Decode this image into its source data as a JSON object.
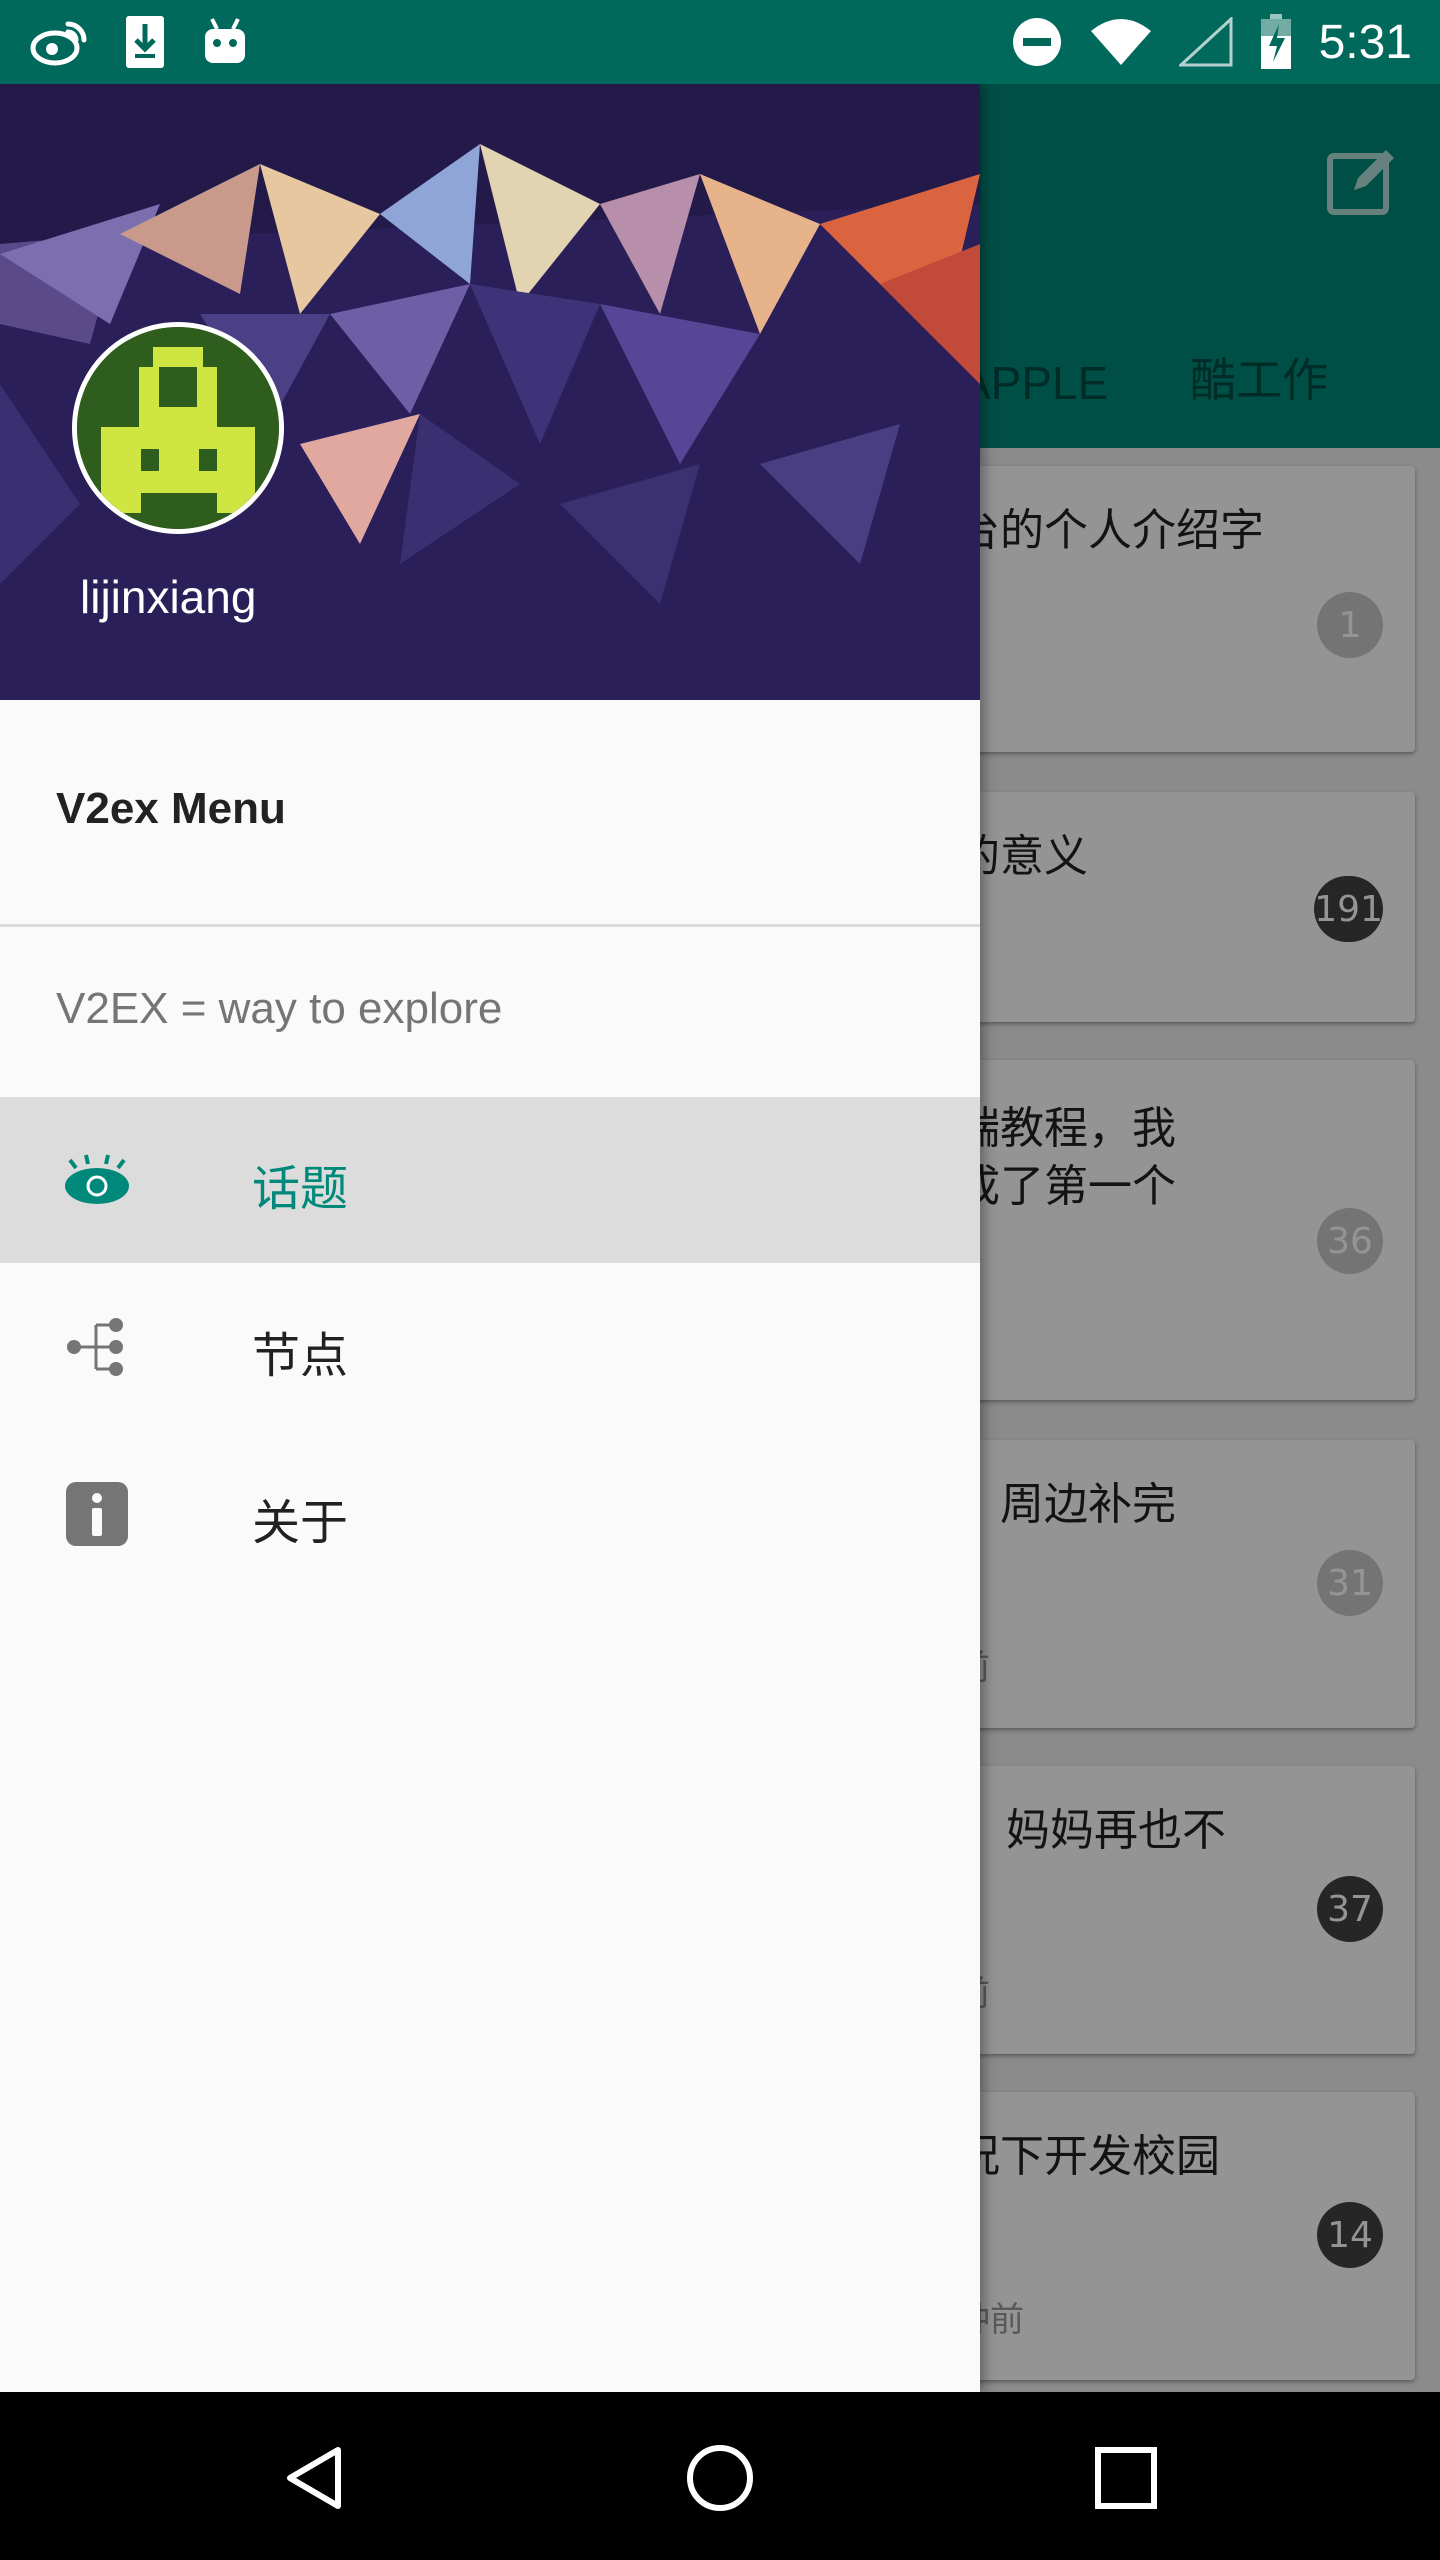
{
  "status_bar": {
    "time": "5:31",
    "icons_left": [
      "weibo-icon",
      "download-icon",
      "android-icon"
    ],
    "icons_right": [
      "do-not-disturb-icon",
      "wifi-icon",
      "signal-icon",
      "battery-charging-icon"
    ]
  },
  "app": {
    "tabs": [
      "APPLE",
      "酷工作"
    ],
    "cards": [
      {
        "title": "台的个人介绍字",
        "title2": "",
        "replies": "1",
        "time": ""
      },
      {
        "title": "的意义",
        "title2": "",
        "replies": "191",
        "time": ""
      },
      {
        "title": "端教程，我",
        "title2": "成了第一个",
        "replies": "36",
        "time": ""
      },
      {
        "title": "」周边补完",
        "title2": "",
        "replies": "31",
        "time": "前"
      },
      {
        "title": "妈妈再也不",
        "title2": "",
        "replies": "37",
        "time": "前"
      },
      {
        "title": "况下开发校园",
        "title2": "",
        "replies": "14",
        "time": "钟前"
      }
    ]
  },
  "drawer": {
    "username": "lijinxiang",
    "menu_title": "V2ex Menu",
    "subheader": "V2EX = way to explore",
    "items": [
      {
        "label": "话题",
        "icon": "eye-icon",
        "active": true
      },
      {
        "label": "节点",
        "icon": "node-tree-icon",
        "active": false
      },
      {
        "label": "关于",
        "icon": "info-icon",
        "active": false
      }
    ],
    "accent_color": "#00897b",
    "primary_dark": "#00695c"
  },
  "nav_bar": [
    "back-icon",
    "home-icon",
    "recents-icon"
  ]
}
